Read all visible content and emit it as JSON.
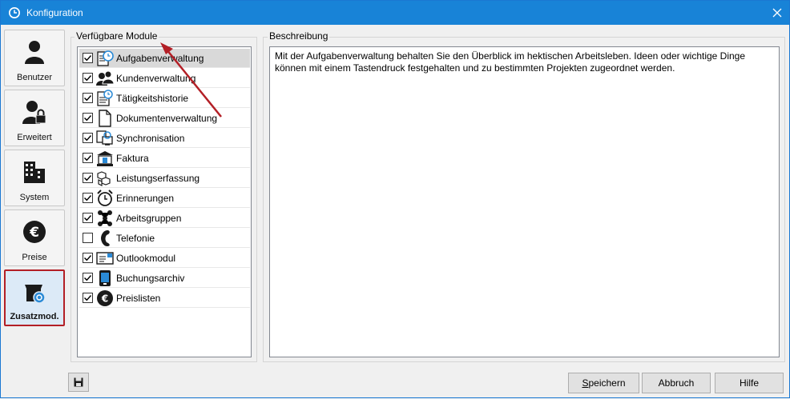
{
  "window": {
    "title": "Konfiguration",
    "title_icon": "clock-icon",
    "close_icon": "close-icon"
  },
  "nav": {
    "items": [
      {
        "label": "Benutzer",
        "icon": "user-icon"
      },
      {
        "label": "Erweitert",
        "icon": "user-lock-icon"
      },
      {
        "label": "System",
        "icon": "building-icon"
      },
      {
        "label": "Preise",
        "icon": "euro-icon"
      },
      {
        "label": "Zusatzmod.",
        "icon": "module-box-icon",
        "active": true
      }
    ]
  },
  "modules": {
    "group_label": "Verfügbare Module",
    "items": [
      {
        "label": "Aufgabenverwaltung",
        "checked": true,
        "icon": "task-clock-icon",
        "selected": true
      },
      {
        "label": "Kundenverwaltung",
        "checked": true,
        "icon": "customers-icon"
      },
      {
        "label": "Tätigkeitshistorie",
        "checked": true,
        "icon": "history-icon"
      },
      {
        "label": "Dokumentenverwaltung",
        "checked": true,
        "icon": "document-icon"
      },
      {
        "label": "Synchronisation",
        "checked": true,
        "icon": "sync-icon"
      },
      {
        "label": "Faktura",
        "checked": true,
        "icon": "bank-icon"
      },
      {
        "label": "Leistungserfassung",
        "checked": true,
        "icon": "cubes-icon"
      },
      {
        "label": "Erinnerungen",
        "checked": true,
        "icon": "alarm-clock-icon"
      },
      {
        "label": "Arbeitsgruppen",
        "checked": true,
        "icon": "group-icon"
      },
      {
        "label": "Telefonie",
        "checked": false,
        "icon": "phone-icon"
      },
      {
        "label": "Outlookmodul",
        "checked": true,
        "icon": "outlook-icon"
      },
      {
        "label": "Buchungsarchiv",
        "checked": true,
        "icon": "archive-icon"
      },
      {
        "label": "Preislisten",
        "checked": true,
        "icon": "euro-circle-icon"
      }
    ]
  },
  "description": {
    "group_label": "Beschreibung",
    "text": "Mit der Aufgabenverwaltung behalten Sie den Überblick im hektischen Arbeitsleben. Ideen oder wichtige Dinge können mit einem Tastendruck festgehalten und zu bestimmten Projekten zugeordnet werden."
  },
  "footer": {
    "save_icon": "floppy-icon",
    "save_prefix": "S",
    "save_rest": "peichern",
    "cancel_label": "Abbruch",
    "help_label": "Hilfe"
  },
  "colors": {
    "titlebar": "#1883d7",
    "active_border": "#b31f26",
    "arrow": "#b31f26"
  }
}
